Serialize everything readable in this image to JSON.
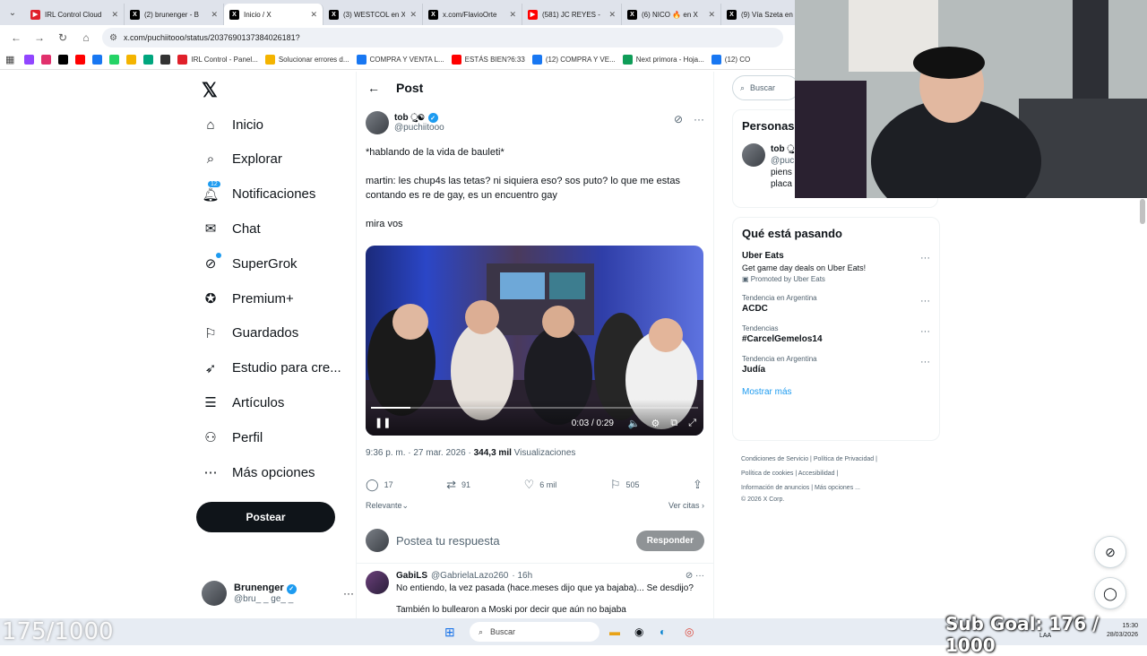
{
  "tabs": [
    {
      "title": "IRL Control Cloud",
      "color": "#e0202a",
      "glyph": "▶"
    },
    {
      "title": "(2) brunenger - B",
      "color": "#000000",
      "glyph": "X"
    },
    {
      "title": "Inicio / X",
      "color": "#000000",
      "glyph": "X",
      "active": true
    },
    {
      "title": "(3) WESTCOL en X",
      "color": "#000000",
      "glyph": "X"
    },
    {
      "title": "x.com/FlavioOrte",
      "color": "#000000",
      "glyph": "X"
    },
    {
      "title": "(581) JC REYES -",
      "color": "#ff0000",
      "glyph": "▶"
    },
    {
      "title": "(6) NICO 🔥 en X",
      "color": "#000000",
      "glyph": "X"
    },
    {
      "title": "(9) Vía Szeta en X",
      "color": "#000000",
      "glyph": "X"
    }
  ],
  "url": "x.com/puchiitooo/status/2037690137384026181?",
  "bookmarks": [
    {
      "label": "",
      "color": "#9146ff"
    },
    {
      "label": "",
      "color": "#e1306c"
    },
    {
      "label": "",
      "color": "#000000"
    },
    {
      "label": "",
      "color": "#ff0000"
    },
    {
      "label": "",
      "color": "#1877f2"
    },
    {
      "label": "",
      "color": "#25d366"
    },
    {
      "label": "",
      "color": "#f4b400"
    },
    {
      "label": "",
      "color": "#00a67e"
    },
    {
      "label": "",
      "color": "#333333"
    },
    {
      "label": "IRL Control - Panel...",
      "color": "#e0202a"
    },
    {
      "label": "Solucionar errores d...",
      "color": "#f4b400"
    },
    {
      "label": "COMPRA Y VENTA L...",
      "color": "#1877f2"
    },
    {
      "label": "ESTÁS BIEN?6:33",
      "color": "#ff0000"
    },
    {
      "label": "(12) COMPRA Y VE...",
      "color": "#1877f2"
    },
    {
      "label": "Next primora - Hoja...",
      "color": "#0f9d58"
    },
    {
      "label": "(12) CO",
      "color": "#1877f2"
    }
  ],
  "nav": {
    "items": [
      {
        "label": "Inicio",
        "icon": "home-icon"
      },
      {
        "label": "Explorar",
        "icon": "search-icon"
      },
      {
        "label": "Notificaciones",
        "icon": "bell-icon",
        "badge": "12"
      },
      {
        "label": "Chat",
        "icon": "mail-icon"
      },
      {
        "label": "SuperGrok",
        "icon": "grok-icon"
      },
      {
        "label": "Premium+",
        "icon": "premium-icon"
      },
      {
        "label": "Guardados",
        "icon": "bookmark-icon"
      },
      {
        "label": "Estudio para cre...",
        "icon": "rocket-icon"
      },
      {
        "label": "Artículos",
        "icon": "article-icon"
      },
      {
        "label": "Perfil",
        "icon": "person-icon"
      },
      {
        "label": "Más opciones",
        "icon": "more-circle-icon"
      }
    ],
    "post_button": "Postear",
    "account": {
      "name": "Brunenger",
      "handle": "@bru_ _ ge_ _"
    }
  },
  "post": {
    "header": "Post",
    "author": "tob ુ☯",
    "handle": "@puchiitooo",
    "text1": "*hablando de la vida de bauleti*",
    "text2": "martin: les chup4s las tetas? ni siquiera eso? sos puto? lo que me estas contando es re de gay, es un encuentro gay",
    "text3": "mira vos",
    "video": {
      "time": "0:03 / 0:29",
      "progress": 0.12
    },
    "meta_time": "9:36 p. m. · 27 mar. 2026 ·",
    "views": "344,3 mil",
    "views_label": "Visualizaciones",
    "stats": {
      "replies": "17",
      "reposts": "91",
      "likes": "6 mil",
      "bookmarks": "505"
    },
    "sort": "Relevante",
    "quotes": "Ver citas",
    "reply_placeholder": "Postea tu respuesta",
    "reply_button": "Responder"
  },
  "comment": {
    "author": "GabiLS",
    "handle": "@GabrielaLazo260",
    "time": "· 16h",
    "line1": "No entiendo, la vez pasada (hace.meses dijo que ya bajaba)... Se desdijo?",
    "line2": "También lo bullearon a Moski por decir que aún no bajaba"
  },
  "right": {
    "search_placeholder": "Buscar",
    "people_title": "Personas",
    "person": {
      "name": "tob ુ",
      "handle": "@puc",
      "bio1": "piens",
      "bio2": "placa"
    },
    "trending_title": "Qué está pasando",
    "trends": [
      {
        "sub": "",
        "main": "Uber Eats",
        "desc": "Get game day deals on Uber Eats!",
        "promo": "Promoted by Uber Eats"
      },
      {
        "sub": "Tendencia en Argentina",
        "main": "ACDC",
        "desc": "",
        "promo": ""
      },
      {
        "sub": "Tendencias",
        "main": "#CarcelGemelos14",
        "desc": "",
        "promo": ""
      },
      {
        "sub": "Tendencia en Argentina",
        "main": "Judía",
        "desc": "",
        "promo": ""
      }
    ],
    "show_more": "Mostrar más",
    "footer": {
      "l1a": "Condiciones de Servicio",
      "l1b": "Política de Privacidad",
      "l2a": "Política de cookies",
      "l2b": "Accesibilidad",
      "l3a": "Información de anuncios",
      "l3b": "Más opciones ...",
      "copy": "© 2026 X Corp."
    }
  },
  "overlay": {
    "left": "175/1000",
    "right": "Sub Goal: 176 / 1000"
  },
  "taskbar": {
    "search": "Buscar",
    "time": "15:30",
    "date": "28/03/2026",
    "lang": "LAA"
  }
}
